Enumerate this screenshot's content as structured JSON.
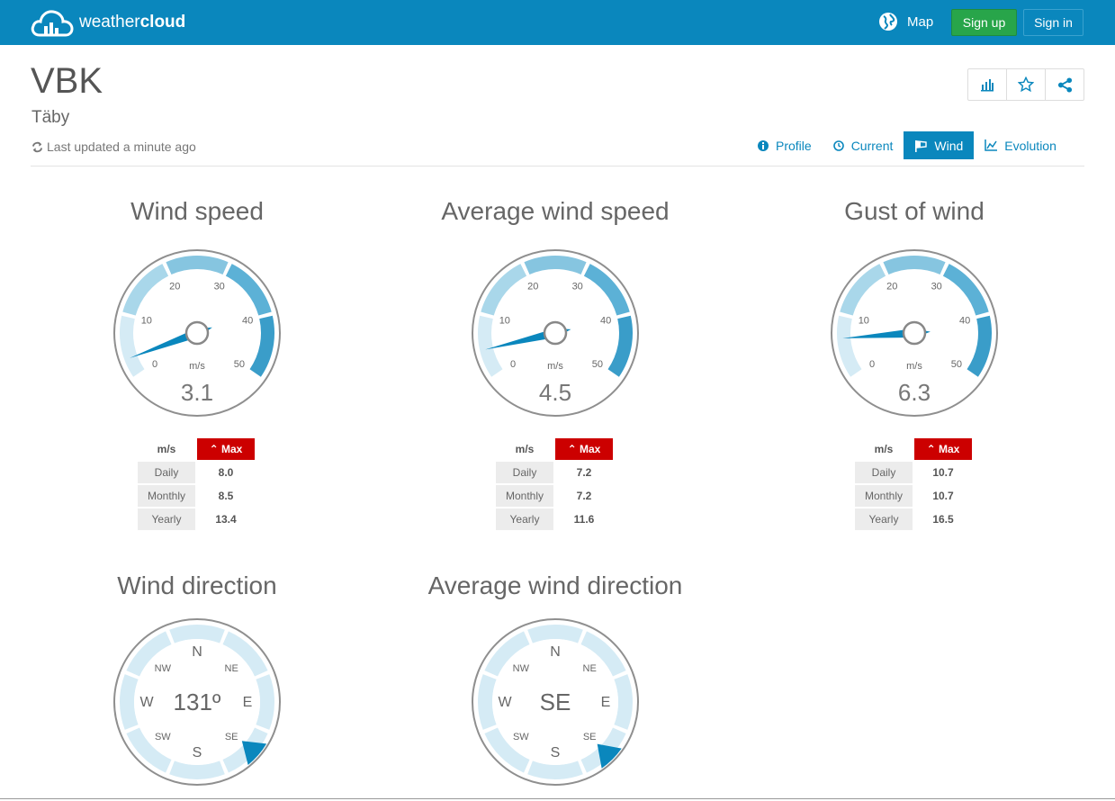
{
  "brand": {
    "name_light": "weather",
    "name_bold": "cloud"
  },
  "nav": {
    "map": "Map",
    "signup": "Sign up",
    "signin": "Sign in"
  },
  "station": {
    "name": "VBK",
    "place": "Täby",
    "last_updated": "Last updated a minute ago"
  },
  "tabs": [
    {
      "label": "Profile",
      "active": false
    },
    {
      "label": "Current",
      "active": false
    },
    {
      "label": "Wind",
      "active": true
    },
    {
      "label": "Evolution",
      "active": false
    }
  ],
  "gauges": [
    {
      "title": "Wind speed",
      "value": 3.1,
      "value_label": "3.1",
      "unit": "m/s",
      "ticks": [
        "0",
        "10",
        "20",
        "30",
        "40",
        "50"
      ],
      "max_header": "Max",
      "rows": [
        {
          "label": "Daily",
          "value": "8.0"
        },
        {
          "label": "Monthly",
          "value": "8.5"
        },
        {
          "label": "Yearly",
          "value": "13.4"
        }
      ]
    },
    {
      "title": "Average wind speed",
      "value": 4.5,
      "value_label": "4.5",
      "unit": "m/s",
      "ticks": [
        "0",
        "10",
        "20",
        "30",
        "40",
        "50"
      ],
      "max_header": "Max",
      "rows": [
        {
          "label": "Daily",
          "value": "7.2"
        },
        {
          "label": "Monthly",
          "value": "7.2"
        },
        {
          "label": "Yearly",
          "value": "11.6"
        }
      ]
    },
    {
      "title": "Gust of wind",
      "value": 6.3,
      "value_label": "6.3",
      "unit": "m/s",
      "ticks": [
        "0",
        "10",
        "20",
        "30",
        "40",
        "50"
      ],
      "max_header": "Max",
      "rows": [
        {
          "label": "Daily",
          "value": "10.7"
        },
        {
          "label": "Monthly",
          "value": "10.7"
        },
        {
          "label": "Yearly",
          "value": "16.5"
        }
      ]
    }
  ],
  "compasses": [
    {
      "title": "Wind direction",
      "center_label": "131º",
      "direction_deg": 131,
      "labels": [
        "N",
        "NE",
        "E",
        "SE",
        "S",
        "SW",
        "W",
        "NW"
      ]
    },
    {
      "title": "Average wind direction",
      "center_label": "SE",
      "direction_deg": 135,
      "labels": [
        "N",
        "NE",
        "E",
        "SE",
        "S",
        "SW",
        "W",
        "NW"
      ]
    }
  ],
  "colors": {
    "brand": "#0a87bd",
    "signup": "#28a54a",
    "max": "#cc0000",
    "needle": "#0a87bd"
  }
}
